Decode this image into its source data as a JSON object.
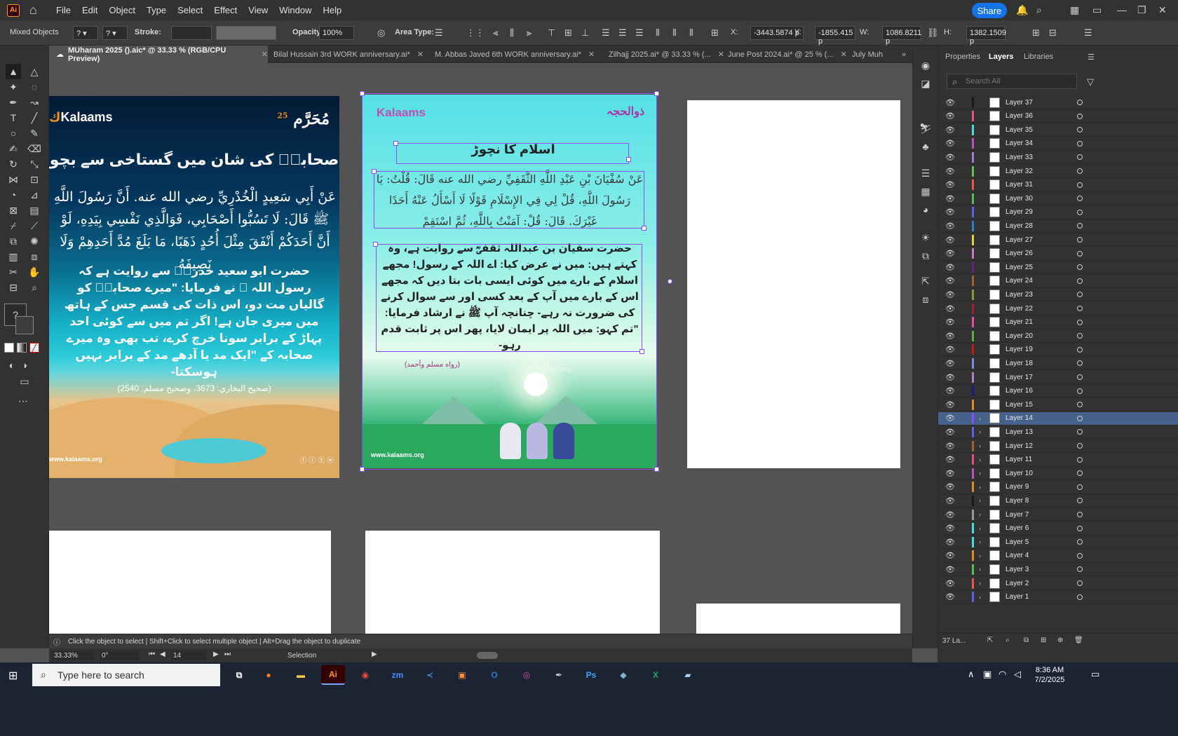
{
  "menubar": {
    "app_logo": "Ai",
    "items": [
      "File",
      "Edit",
      "Object",
      "Type",
      "Select",
      "Effect",
      "View",
      "Window",
      "Help"
    ],
    "share_label": "Share"
  },
  "control_bar": {
    "selection_type": "Mixed Objects",
    "stroke_label": "Stroke:",
    "opacity_label": "Opacity:",
    "opacity_value": "100%",
    "area_type_label": "Area Type:",
    "x_label": "X:",
    "x_value": "-3443.5874 p",
    "y_label": "Y:",
    "y_value": "-1855.415 p",
    "w_label": "W:",
    "w_value": "1086.8211 p",
    "h_label": "H:",
    "h_value": "1382.1509 p"
  },
  "tabs": [
    {
      "label": "MUharam 2025 ().aic* @ 33.33 % (RGB/CPU Preview)",
      "active": true
    },
    {
      "label": "Bilal Hussain  3rd  WORK anniversary.ai*",
      "active": false
    },
    {
      "label": "M. Abbas Javed  6th  WORK anniversary.ai*",
      "active": false
    },
    {
      "label": "Zilhajj 2025.ai* @ 33.33 % (...",
      "active": false
    },
    {
      "label": "June Post 2024.ai* @ 25 % (...",
      "active": false
    },
    {
      "label": "July Muh",
      "active": false
    }
  ],
  "artboard1": {
    "logo": "Kalaams",
    "month_badge": "مُحَرَّم",
    "month_num": "25",
    "title": "صحابہؓ کی شان میں گستاخی سے بچو",
    "arabic": "عَنْ أَبِي سَعِيدٍ الْخُدْرِيِّ رضي الله عنه. أَنَّ رَسُولَ اللَّهِ ﷺ قَالَ: لَا تَسُبُّوا أَصْحَابِي، فَوَالَّذِي نَفْسِي بِيَدِهِ، لَوْ أَنَّ أَحَدَكُمْ أَنْفَقَ مِثْلَ أُحُدٍ ذَهَبًا، مَا بَلَغَ مُدَّ أَحَدِهِمْ وَلَا نَصِيفَهُ",
    "urdu": "حضرت ابو سعید خدریؓ سے روایت ہے کہ رسول اللہ ﷺ نے فرمایا: \"میرے صحابہؓ کو گالیاں مت دو، اس ذات کی قسم جس کے ہاتھ میں میری جان ہے! اگر تم میں سے کوئی احد پہاڑ کے برابر سونا خرچ کرے، تب بھی وہ میرے صحابہ کے \"ایک مد یا آدھے مد کے برابر نہیں ہوسکتا-",
    "reference": "(صحیح البخاري: 3673، وصحیح مسلم: 2540)",
    "website": "www.kalaams.org"
  },
  "artboard2": {
    "logo": "Kalaams",
    "badge": "ذوالحجہ",
    "title": "اسلام کا نچوڑ",
    "arabic": "عَنْ سُفْيَانَ بْنِ عَبْدِ اللَّهِ الثَّقَفِيِّ رضي الله عنه قَالَ: قُلْتُ: يَا رَسُولَ اللَّهِ، قُلْ لِي فِي الإِسْلَامِ قَوْلًا لَا أَسْأَلُ عَنْهُ أَحَدًا غَيْرَكَ. قَالَ: قُلْ: آمَنْتُ بِاللَّهِ، ثُمَّ اسْتَقِمْ",
    "urdu": "حضرت سفیان بن عبداللہ ثقفیؓ سے روایت ہے، وہ کہتے ہیں: میں نے عرض کیا: اے اللہ کے رسول! مجھے اسلام کے بارے میں کوئی ایسی بات بتا دیں کہ مجھے اس کے بارے میں آپ کے بعد کسی اور سے سوال کرنے کی ضرورت نہ رہے- چنانچہ آپ ﷺ نے ارشاد فرمایا: \"تم کہو: میں اللہ پر ایمان لایا، پھر اس پر ثابت قدم رہو-",
    "reference": "(رواه مسلم وأحمد)",
    "ghost_label": "Ungroup",
    "website": "www.kalaams.org"
  },
  "panel": {
    "tabs": [
      "Properties",
      "Layers",
      "Libraries"
    ],
    "active_tab": "Layers",
    "search_placeholder": "Search All",
    "layers": [
      {
        "name": "Layer 37",
        "color": "#1a1a1a"
      },
      {
        "name": "Layer 36",
        "color": "#e8508a"
      },
      {
        "name": "Layer 35",
        "color": "#4fd8e0"
      },
      {
        "name": "Layer 34",
        "color": "#c24fc7"
      },
      {
        "name": "Layer 33",
        "color": "#9f7fd0"
      },
      {
        "name": "Layer 32",
        "color": "#66c34f"
      },
      {
        "name": "Layer 31",
        "color": "#e65a4f"
      },
      {
        "name": "Layer 30",
        "color": "#4fc24f"
      },
      {
        "name": "Layer 29",
        "color": "#5a64e0"
      },
      {
        "name": "Layer 28",
        "color": "#2a7fd0"
      },
      {
        "name": "Layer 27",
        "color": "#e6d24f"
      },
      {
        "name": "Layer 26",
        "color": "#c27fc7"
      },
      {
        "name": "Layer 25",
        "color": "#6a1f8a"
      },
      {
        "name": "Layer 24",
        "color": "#a06030"
      },
      {
        "name": "Layer 23",
        "color": "#7fa030"
      },
      {
        "name": "Layer 22",
        "color": "#a0203a"
      },
      {
        "name": "Layer 21",
        "color": "#e04fa0"
      },
      {
        "name": "Layer 20",
        "color": "#5fb040"
      },
      {
        "name": "Layer 19",
        "color": "#c01a1a"
      },
      {
        "name": "Layer 18",
        "color": "#7f8fe0"
      },
      {
        "name": "Layer 17",
        "color": "#b07fd0"
      },
      {
        "name": "Layer 16",
        "color": "#1a1a8a"
      },
      {
        "name": "Layer 15",
        "color": "#e08a2a"
      },
      {
        "name": "Layer 14",
        "color": "#8a4dff",
        "selected": true,
        "expandable": true
      },
      {
        "name": "Layer 13",
        "color": "#5a64e0",
        "expandable": true
      },
      {
        "name": "Layer 12",
        "color": "#a06030",
        "expandable": true
      },
      {
        "name": "Layer 11",
        "color": "#e04f8a",
        "expandable": true
      },
      {
        "name": "Layer 10",
        "color": "#c24fc7",
        "expandable": true
      },
      {
        "name": "Layer 9",
        "color": "#e08a2a",
        "expandable": true
      },
      {
        "name": "Layer 8",
        "color": "#1a1a1a",
        "expandable": true
      },
      {
        "name": "Layer 7",
        "color": "#9a9a9a",
        "expandable": true
      },
      {
        "name": "Layer 6",
        "color": "#4fd8e0",
        "expandable": true
      },
      {
        "name": "Layer 5",
        "color": "#4fd8e0",
        "expandable": true
      },
      {
        "name": "Layer 4",
        "color": "#e08a2a",
        "expandable": true
      },
      {
        "name": "Layer 3",
        "color": "#4fc24f",
        "expandable": true
      },
      {
        "name": "Layer 2",
        "color": "#e65a4f",
        "expandable": true
      },
      {
        "name": "Layer 1",
        "color": "#5a64e0",
        "expandable": true
      }
    ],
    "footer_count": "37 La..."
  },
  "hint_bar": "Click the object to select  |  Shift+Click to select multiple object  |  Alt+Drag the object to duplicate",
  "status_bar": {
    "zoom": "33.33%",
    "rotation": "0°",
    "artboard_num": "14",
    "tool": "Selection"
  },
  "taskbar": {
    "search_placeholder": "Type here to search",
    "time": "8:36 AM",
    "date": "7/2/2025"
  }
}
